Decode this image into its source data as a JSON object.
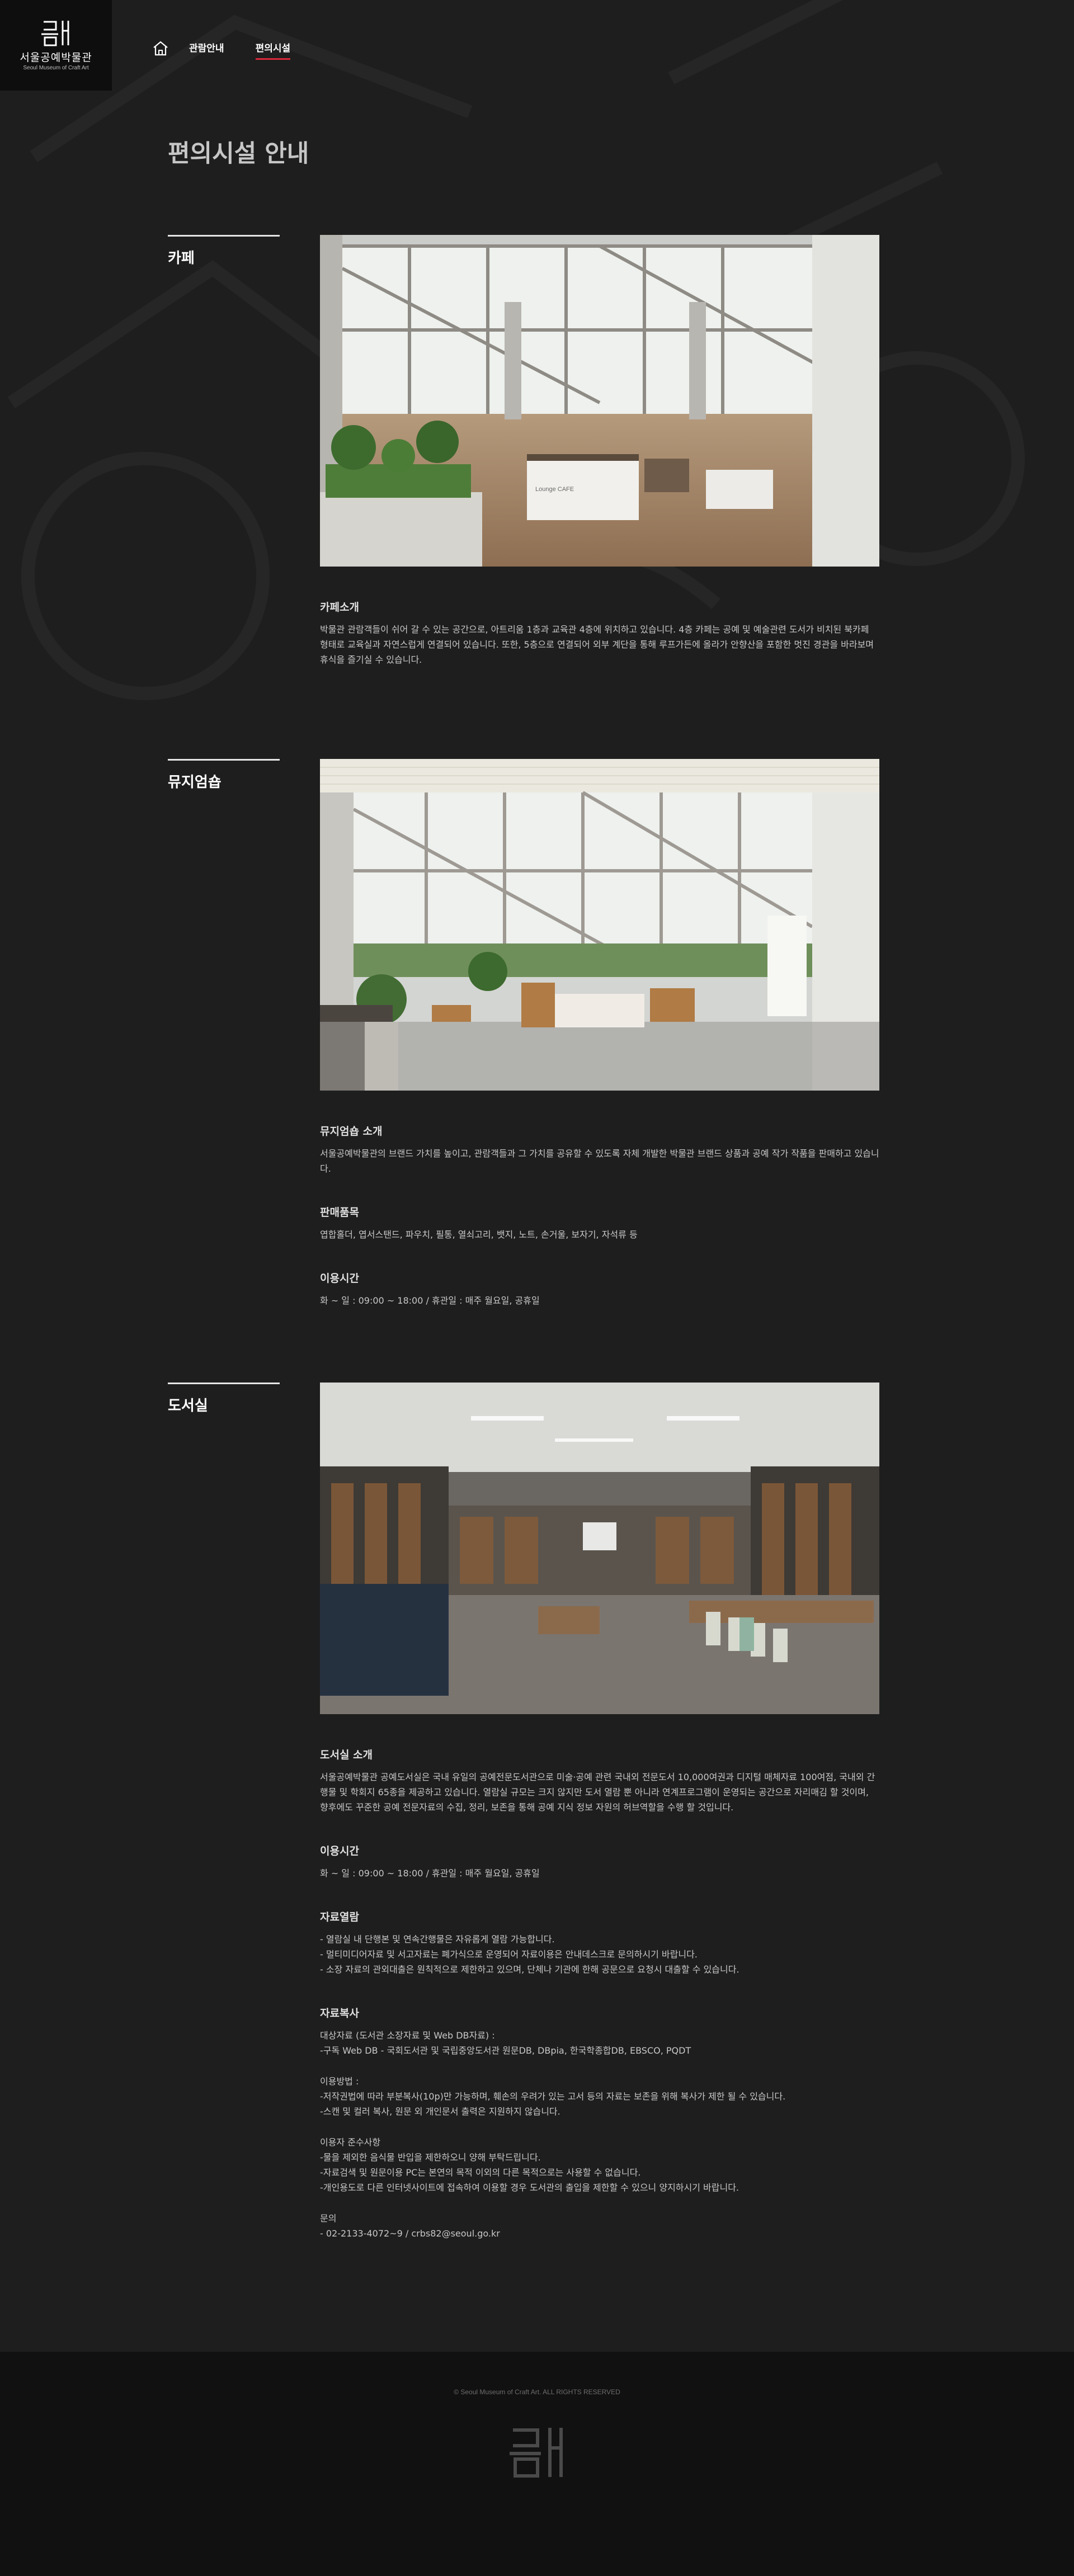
{
  "header": {
    "logo_text": "서울공예박물관",
    "logo_sub": "Seoul Museum of Craft Art",
    "nav": [
      {
        "label": "관람안내",
        "active": false
      },
      {
        "label": "편의시설",
        "active": true
      }
    ],
    "home_icon": "home-icon",
    "accent_color": "#d8283a"
  },
  "page_title": "편의시설 안내",
  "sections": [
    {
      "title": "카페",
      "image_label": "Lounge CAFE",
      "blocks": [
        {
          "subtitle": "카페소개",
          "lines": [
            "박물관 관람객들이 쉬어 갈 수 있는 공간으로, 아트리움 1층과 교육관 4층에 위치하고 있습니다. 4층 카페는 공예 및 예술관련 도서가 비치된 북카페 형태로 교육실과 자연스럽게 연결되어 있습니다. 또한, 5층으로 연결되어 외부 계단을 통해 루프가든에 올라가 안향산을 포함한 멋진 경관을 바라보며 휴식을 즐기실 수 있습니다."
          ]
        }
      ]
    },
    {
      "title": "뮤지엄숍",
      "blocks": [
        {
          "subtitle": "뮤지엄숍 소개",
          "lines": [
            "서울공예박물관의 브랜드 가치를 높이고, 관람객들과 그 가치를 공유할 수 있도록 자체 개발한 박물관 브랜드 상품과 공예 작가 작품을 판매하고 있습니다."
          ]
        },
        {
          "subtitle": "판매품목",
          "lines": [
            "엽합홀더, 엽서스탠드, 파우치, 필통, 열쇠고리, 뱃지, 노트, 손거울, 보자기, 자석류 등"
          ]
        },
        {
          "subtitle": "이용시간",
          "lines": [
            "화 ~ 일 : 09:00 ~ 18:00 / 휴관일 : 매주 월요일, 공휴일"
          ]
        }
      ]
    },
    {
      "title": "도서실",
      "blocks": [
        {
          "subtitle": "도서실 소개",
          "lines": [
            "서울공예박물관 공예도서실은 국내 유일의 공예전문도서관으로 미술·공예 관련 국내외 전문도서 10,000여권과 디지털 매체자료 100여점, 국내외 간행물 및 학회지 65종을 제공하고 있습니다. 열람실 규모는 크지 않지만 도서 열람 뿐 아니라 연계프로그램이 운영되는 공간으로 자리매김 할 것이며, 향후에도 꾸준한 공예 전문자료의 수집, 정리, 보존을 통해 공예 지식 정보 자원의 허브역할을 수행 할 것입니다."
          ]
        },
        {
          "subtitle": "이용시간",
          "lines": [
            "화 ~ 일 : 09:00 ~ 18:00 / 휴관일 : 매주 월요일, 공휴일"
          ]
        },
        {
          "subtitle": "자료열람",
          "lines": [
            "- 열람실 내 단행본 및 연속간행물은 자유롭게 열람 가능합니다.",
            "- 멀티미디어자료 및 서고자료는 폐가식으로 운영되어 자료이용은 안내데스크로 문의하시기 바랍니다.",
            "- 소장 자료의 관외대출은 원칙적으로 제한하고 있으며, 단체나 기관에 한해 공문으로 요청시 대출할 수 있습니다."
          ]
        },
        {
          "subtitle": "자료복사",
          "lines": [
            "대상자료 (도서관 소장자료 및 Web DB자료) :",
            "-구독 Web DB - 국회도서관 및 국립중앙도서관 원문DB, DBpia, 한국학종합DB, EBSCO, PQDT",
            "",
            "이용방법 :",
            "-저작권법에 따라 부분복사(10p)만 가능하며, 훼손의 우려가 있는 고서 등의 자료는 보존을 위해 복사가 제한 될 수 있습니다.",
            "-스캔 및 컬러 복사, 원문 외 개인문서 출력은 지원하지 않습니다.",
            "",
            "이용자 준수사항",
            "-물을 제외한 음식물 반입을 제한하오니 양해 부탁드립니다.",
            "-자료검색 및 원문이용 PC는 본연의 목적 이외의 다른 목적으로는 사용할 수 없습니다.",
            "-개인용도로 다른 인터넷사이트에 접속하여 이용할 경우 도서관의 출입을 제한할 수 있으니 양지하시기 바랍니다.",
            "",
            "문의",
            "- 02-2133-4072~9 / crbs82@seoul.go.kr"
          ]
        }
      ]
    }
  ],
  "footer": {
    "copyright": "© Seoul Museum of Craft Art. ALL RIGHTS RESERVED"
  }
}
